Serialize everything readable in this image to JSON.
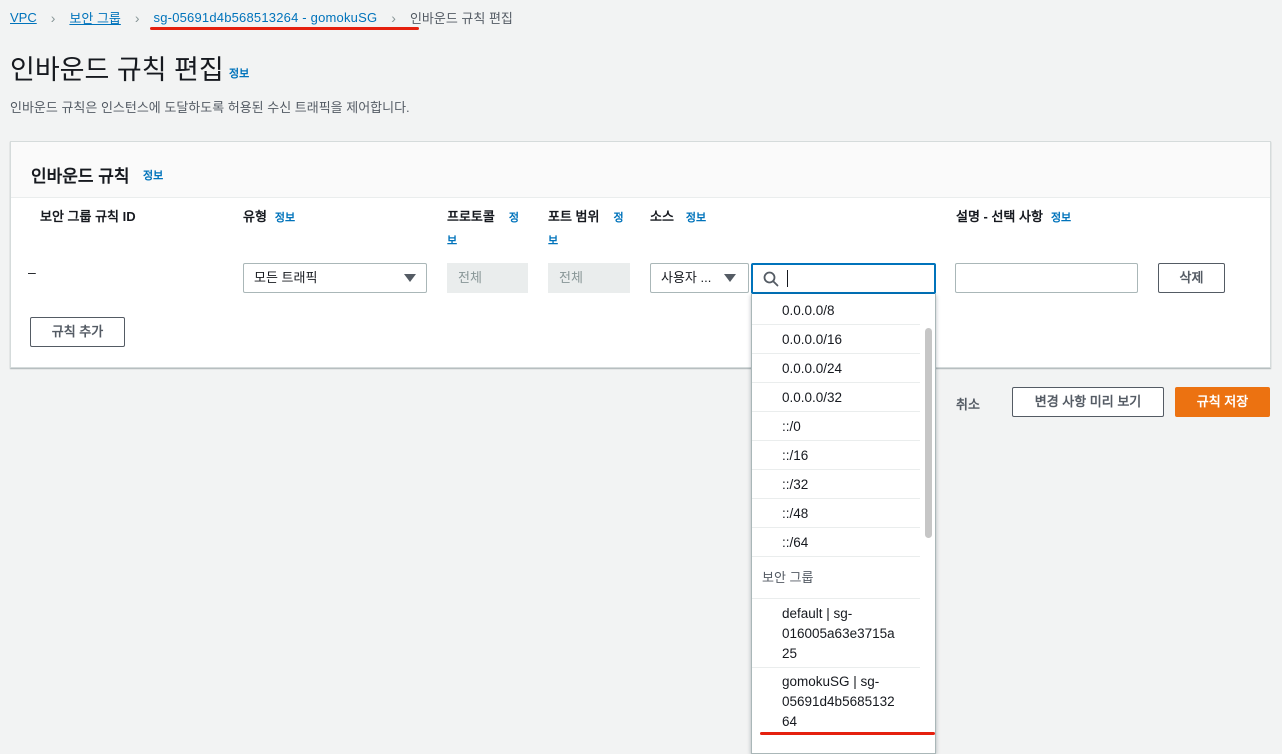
{
  "breadcrumb": {
    "vpc": "VPC",
    "security_groups": "보안 그룹",
    "sg": "sg-05691d4b568513264 - gomokuSG",
    "current": "인바운드 규칙 편집"
  },
  "page": {
    "title": "인바운드 규칙 편집",
    "info": "정보",
    "description": "인바운드 규칙은 인스턴스에 도달하도록 허용된 수신 트래픽을 제어합니다."
  },
  "panel": {
    "title": "인바운드 규칙",
    "info": "정보",
    "columns": {
      "rule_id": "보안 그룹 규칙 ID",
      "type": "유형",
      "protocol_line1": "프로토콜",
      "port_line1": "포트 범위",
      "source": "소스",
      "description": "설명 - 선택 사항",
      "info": "정보",
      "info_line1": "정",
      "info_line2": "보"
    },
    "row": {
      "rule_id": "–",
      "type": "모든 트래픽",
      "protocol": "전체",
      "port": "전체",
      "source_type": "사용자 ...",
      "search_value": "",
      "description_value": "",
      "delete": "삭제"
    },
    "add_rule": "규칙 추가"
  },
  "footer": {
    "cancel": "취소",
    "preview": "변경 사항 미리 보기",
    "save": "규칙 저장"
  },
  "dropdown": {
    "cidr_options": [
      "0.0.0.0/8",
      "0.0.0.0/16",
      "0.0.0.0/24",
      "0.0.0.0/32",
      "::/0",
      "::/16",
      "::/32",
      "::/48",
      "::/64"
    ],
    "group_label": "보안 그룹",
    "sg_options": [
      {
        "line1": "default | sg-",
        "line2": "016005a63e3715a",
        "line3": "25"
      },
      {
        "line1": "gomokuSG | sg-",
        "line2": "05691d4b5685132",
        "line3": "64"
      }
    ]
  },
  "colors": {
    "accent": "#0073bb",
    "primary_button": "#ec7211",
    "highlight": "#e5200e"
  }
}
